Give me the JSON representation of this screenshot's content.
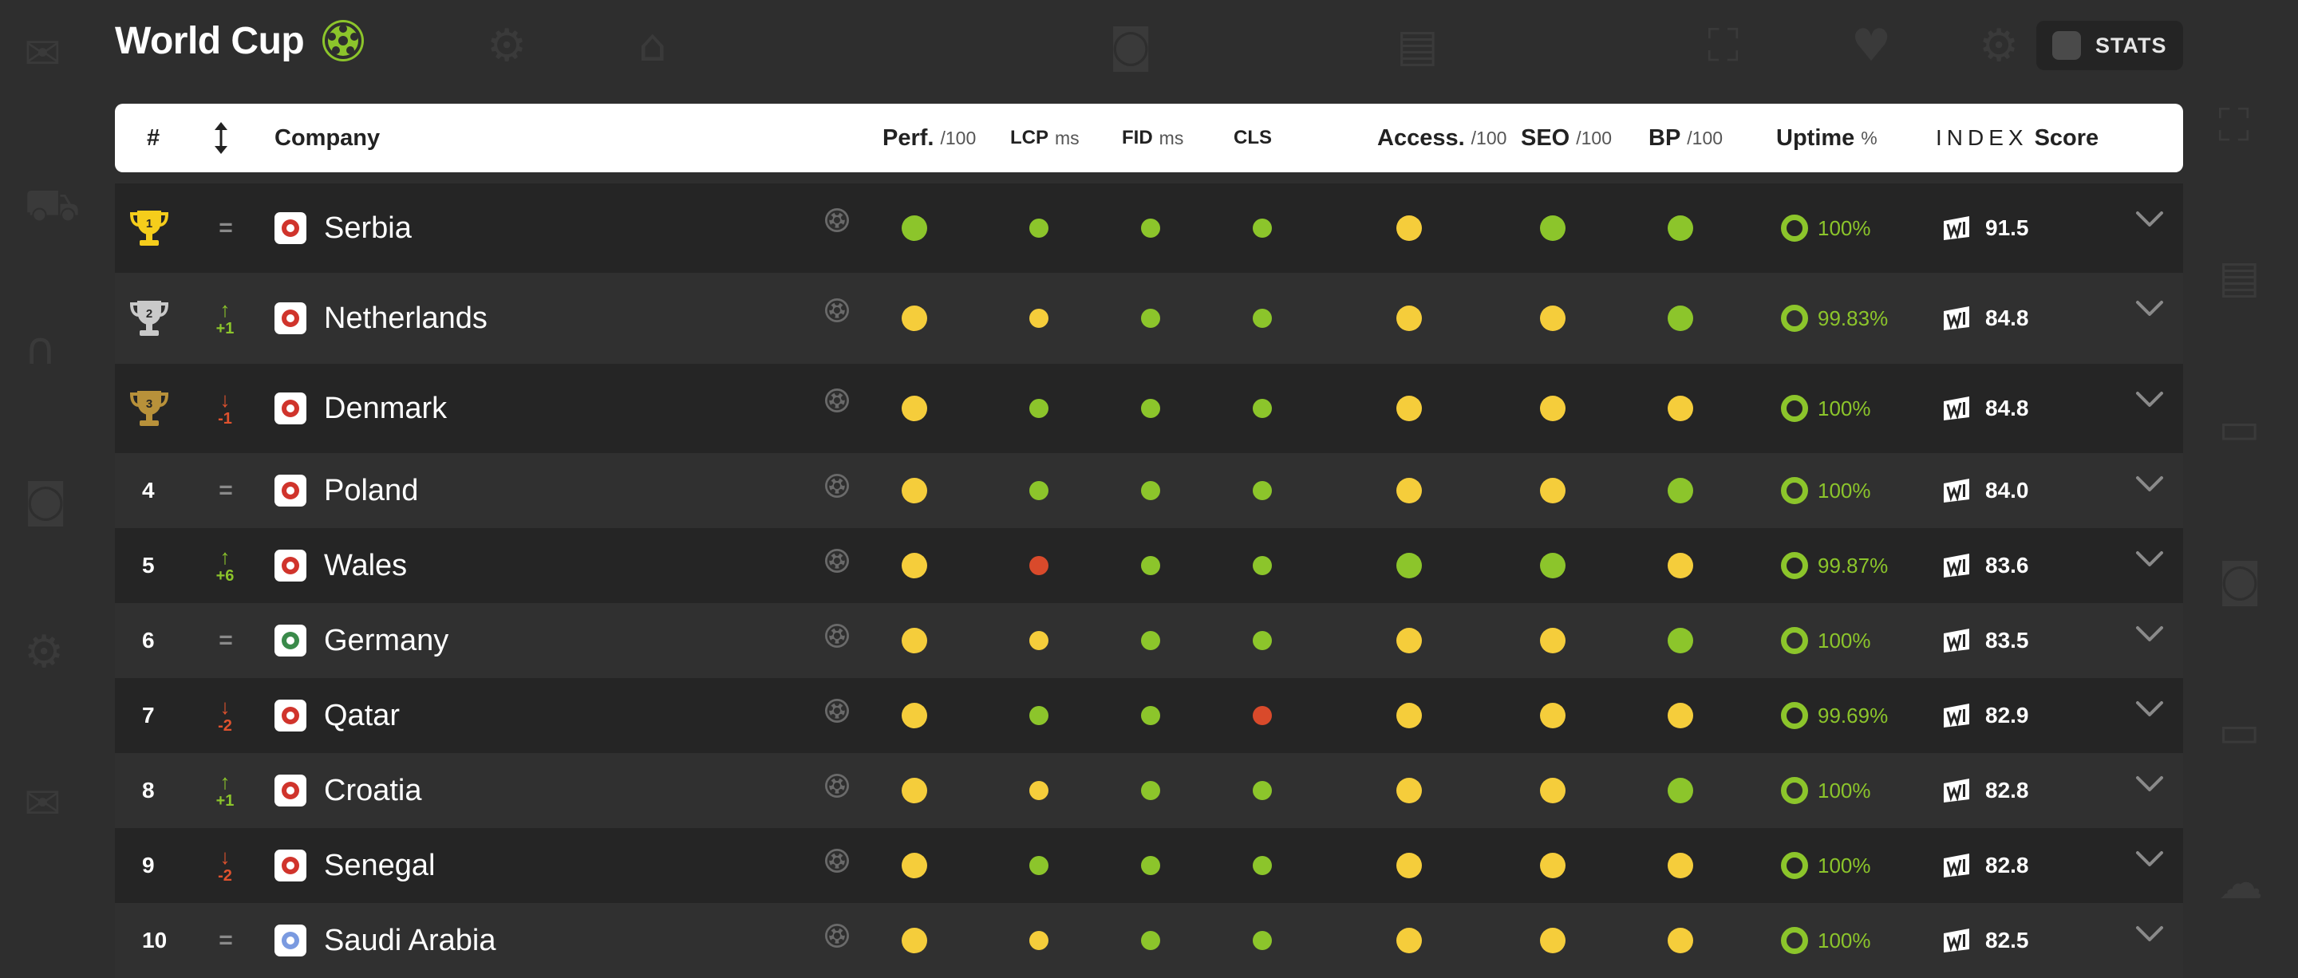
{
  "header": {
    "title": "World Cup",
    "stats_label": "STATS"
  },
  "columns": {
    "rank": "#",
    "company": "Company",
    "perf": "Perf.",
    "perf_unit": "/100",
    "lcp": "LCP",
    "lcp_unit": "ms",
    "fid": "FID",
    "fid_unit": "ms",
    "cls": "CLS",
    "access": "Access.",
    "access_unit": "/100",
    "seo": "SEO",
    "seo_unit": "/100",
    "bp": "BP",
    "bp_unit": "/100",
    "uptime": "Uptime",
    "uptime_unit": "%",
    "index_word": "INDEX",
    "score": "Score"
  },
  "colors": {
    "good": "#8cc52b",
    "average": "#f5cd3b",
    "poor": "#d94a2b",
    "gold": "#f5cd1b",
    "silver": "#c9c9c9",
    "bronze": "#b8913a"
  },
  "rows": [
    {
      "rank": "1",
      "trophy": "gold",
      "move": "=",
      "dir": "same",
      "company": "Serbia",
      "perf": "g",
      "lcp": "g",
      "fid": "g",
      "cls": "g",
      "access": "y",
      "seo": "g",
      "bp": "g",
      "uptime": "100%",
      "score": "91.5"
    },
    {
      "rank": "2",
      "trophy": "silver",
      "move": "+1",
      "dir": "up",
      "company": "Netherlands",
      "perf": "y",
      "lcp": "y",
      "fid": "g",
      "cls": "g",
      "access": "y",
      "seo": "y",
      "bp": "g",
      "uptime": "99.83%",
      "score": "84.8"
    },
    {
      "rank": "3",
      "trophy": "bronze",
      "move": "-1",
      "dir": "down",
      "company": "Denmark",
      "perf": "y",
      "lcp": "g",
      "fid": "g",
      "cls": "g",
      "access": "y",
      "seo": "y",
      "bp": "y",
      "uptime": "100%",
      "score": "84.8"
    },
    {
      "rank": "4",
      "trophy": "",
      "move": "=",
      "dir": "same",
      "company": "Poland",
      "perf": "y",
      "lcp": "g",
      "fid": "g",
      "cls": "g",
      "access": "y",
      "seo": "y",
      "bp": "g",
      "uptime": "100%",
      "score": "84.0"
    },
    {
      "rank": "5",
      "trophy": "",
      "move": "+6",
      "dir": "up",
      "company": "Wales",
      "perf": "y",
      "lcp": "r",
      "fid": "g",
      "cls": "g",
      "access": "g",
      "seo": "g",
      "bp": "y",
      "uptime": "99.87%",
      "score": "83.6"
    },
    {
      "rank": "6",
      "trophy": "",
      "move": "=",
      "dir": "same",
      "company": "Germany",
      "perf": "y",
      "lcp": "y",
      "fid": "g",
      "cls": "g",
      "access": "y",
      "seo": "y",
      "bp": "g",
      "uptime": "100%",
      "score": "83.5"
    },
    {
      "rank": "7",
      "trophy": "",
      "move": "-2",
      "dir": "down",
      "company": "Qatar",
      "perf": "y",
      "lcp": "g",
      "fid": "g",
      "cls": "r",
      "access": "y",
      "seo": "y",
      "bp": "y",
      "uptime": "99.69%",
      "score": "82.9"
    },
    {
      "rank": "8",
      "trophy": "",
      "move": "+1",
      "dir": "up",
      "company": "Croatia",
      "perf": "y",
      "lcp": "y",
      "fid": "g",
      "cls": "g",
      "access": "y",
      "seo": "y",
      "bp": "g",
      "uptime": "100%",
      "score": "82.8"
    },
    {
      "rank": "9",
      "trophy": "",
      "move": "-2",
      "dir": "down",
      "company": "Senegal",
      "perf": "y",
      "lcp": "g",
      "fid": "g",
      "cls": "g",
      "access": "y",
      "seo": "y",
      "bp": "y",
      "uptime": "100%",
      "score": "82.8"
    },
    {
      "rank": "10",
      "trophy": "",
      "move": "=",
      "dir": "same",
      "company": "Saudi Arabia",
      "perf": "y",
      "lcp": "y",
      "fid": "g",
      "cls": "g",
      "access": "y",
      "seo": "y",
      "bp": "y",
      "uptime": "100%",
      "score": "82.5"
    }
  ]
}
